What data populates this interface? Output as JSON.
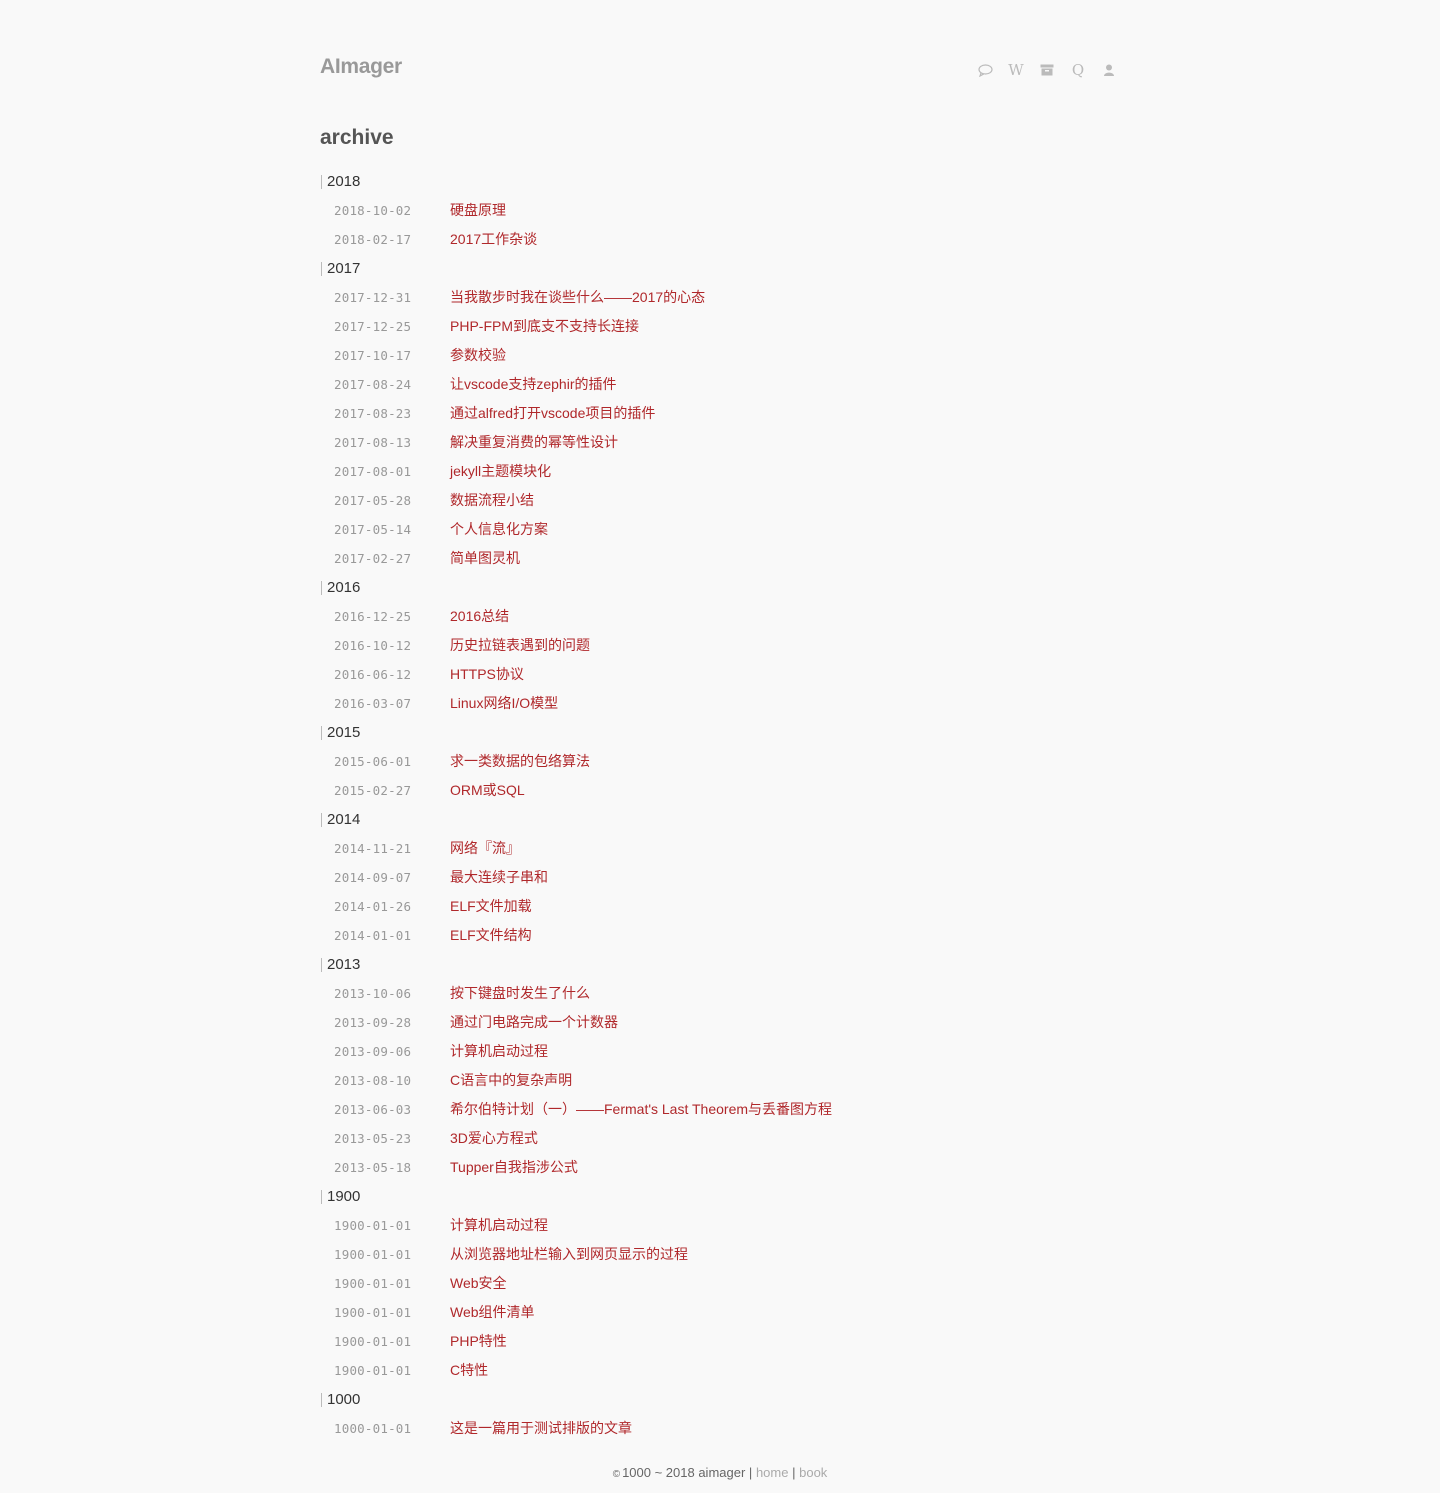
{
  "site": {
    "title": "AImager"
  },
  "nav": [
    {
      "name": "comment-icon",
      "glyph": ""
    },
    {
      "name": "wiki-icon",
      "glyph": "W"
    },
    {
      "name": "archive-icon",
      "glyph": ""
    },
    {
      "name": "search-icon",
      "glyph": "Q"
    },
    {
      "name": "user-icon",
      "glyph": ""
    }
  ],
  "page": {
    "title": "archive"
  },
  "archive": [
    {
      "year": "2018",
      "posts": [
        {
          "date": "2018-10-02",
          "title": "硬盘原理"
        },
        {
          "date": "2018-02-17",
          "title": "2017工作杂谈"
        }
      ]
    },
    {
      "year": "2017",
      "posts": [
        {
          "date": "2017-12-31",
          "title": "当我散步时我在谈些什么——2017的心态"
        },
        {
          "date": "2017-12-25",
          "title": "PHP-FPM到底支不支持长连接"
        },
        {
          "date": "2017-10-17",
          "title": "参数校验"
        },
        {
          "date": "2017-08-24",
          "title": "让vscode支持zephir的插件"
        },
        {
          "date": "2017-08-23",
          "title": "通过alfred打开vscode项目的插件"
        },
        {
          "date": "2017-08-13",
          "title": "解决重复消费的幂等性设计"
        },
        {
          "date": "2017-08-01",
          "title": "jekyll主题模块化"
        },
        {
          "date": "2017-05-28",
          "title": "数据流程小结"
        },
        {
          "date": "2017-05-14",
          "title": "个人信息化方案"
        },
        {
          "date": "2017-02-27",
          "title": "简单图灵机"
        }
      ]
    },
    {
      "year": "2016",
      "posts": [
        {
          "date": "2016-12-25",
          "title": "2016总结"
        },
        {
          "date": "2016-10-12",
          "title": "历史拉链表遇到的问题"
        },
        {
          "date": "2016-06-12",
          "title": "HTTPS协议"
        },
        {
          "date": "2016-03-07",
          "title": "Linux网络I/O模型"
        }
      ]
    },
    {
      "year": "2015",
      "posts": [
        {
          "date": "2015-06-01",
          "title": "求一类数据的包络算法"
        },
        {
          "date": "2015-02-27",
          "title": "ORM或SQL"
        }
      ]
    },
    {
      "year": "2014",
      "posts": [
        {
          "date": "2014-11-21",
          "title": "网络『流』"
        },
        {
          "date": "2014-09-07",
          "title": "最大连续子串和"
        },
        {
          "date": "2014-01-26",
          "title": "ELF文件加载"
        },
        {
          "date": "2014-01-01",
          "title": "ELF文件结构"
        }
      ]
    },
    {
      "year": "2013",
      "posts": [
        {
          "date": "2013-10-06",
          "title": "按下键盘时发生了什么"
        },
        {
          "date": "2013-09-28",
          "title": "通过门电路完成一个计数器"
        },
        {
          "date": "2013-09-06",
          "title": "计算机启动过程"
        },
        {
          "date": "2013-08-10",
          "title": "C语言中的复杂声明"
        },
        {
          "date": "2013-06-03",
          "title": "希尔伯特计划（一）——Fermat's Last Theorem与丢番图方程"
        },
        {
          "date": "2013-05-23",
          "title": "3D爱心方程式"
        },
        {
          "date": "2013-05-18",
          "title": "Tupper自我指涉公式"
        }
      ]
    },
    {
      "year": "1900",
      "posts": [
        {
          "date": "1900-01-01",
          "title": "计算机启动过程"
        },
        {
          "date": "1900-01-01",
          "title": "从浏览器地址栏输入到网页显示的过程"
        },
        {
          "date": "1900-01-01",
          "title": "Web安全"
        },
        {
          "date": "1900-01-01",
          "title": "Web组件清单"
        },
        {
          "date": "1900-01-01",
          "title": "PHP特性"
        },
        {
          "date": "1900-01-01",
          "title": "C特性"
        }
      ]
    },
    {
      "year": "1000",
      "posts": [
        {
          "date": "1000-01-01",
          "title": "这是一篇用于测试排版的文章"
        }
      ]
    }
  ],
  "footer": {
    "copyright_mark": "©",
    "copyright_text": "1000 ~ 2018 aimager",
    "separator": "|",
    "home_label": "home",
    "book_label": "book"
  },
  "colors": {
    "link": "#b0282b",
    "background": "#f9f9f9",
    "muted": "#999999"
  }
}
